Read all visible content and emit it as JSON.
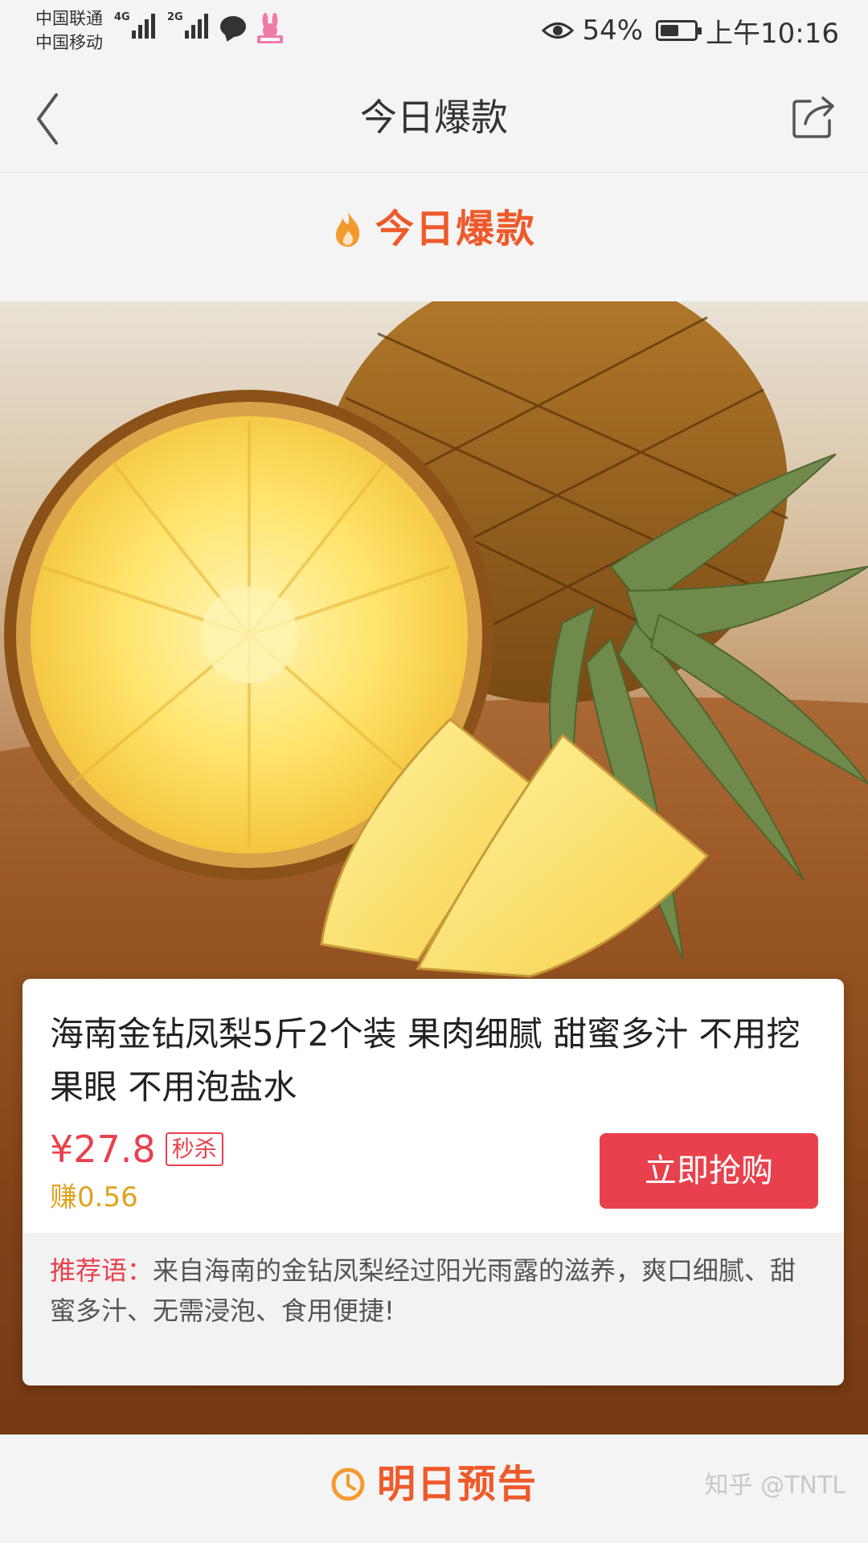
{
  "status_bar": {
    "carrier_1": "中国联通",
    "carrier_2": "中国移动",
    "network_1": "4G",
    "network_2": "2G",
    "battery_percent": "54%",
    "battery_level": 0.54,
    "time": "上午10:16"
  },
  "nav": {
    "title": "今日爆款",
    "back_icon": "chevron-left-icon",
    "share_icon": "share-icon"
  },
  "section": {
    "title": "今日爆款",
    "icon": "fire-icon",
    "accent_color": "#ee5a2a"
  },
  "product": {
    "image": "pineapple-product-image",
    "title": "海南金钻凤梨5斤2个装 果肉细腻 甜蜜多汁 不用挖果眼 不用泡盐水",
    "price": "¥27.8",
    "price_tag": "秒杀",
    "earn": "赚0.56",
    "buy_label": "立即抢购",
    "price_color": "#e8414d",
    "earn_color": "#e0a21c",
    "recommend_label": "推荐语：",
    "recommend_text": "来自海南的金钻凤梨经过阳光雨露的滋养，爽口细腻、甜蜜多汁、无需浸泡、食用便捷!"
  },
  "bottom": {
    "title": "明日预告",
    "icon": "clock-icon",
    "watermark": "知乎 @TNTL"
  }
}
